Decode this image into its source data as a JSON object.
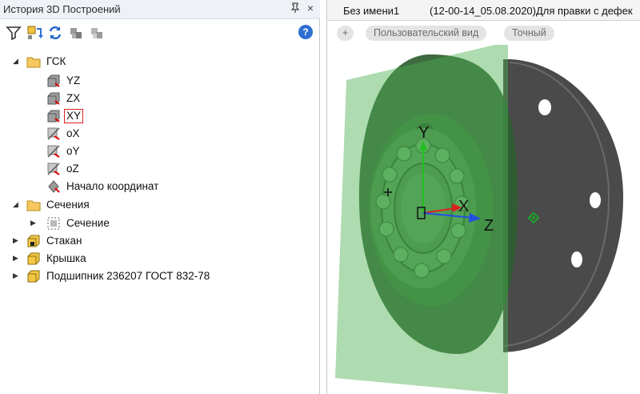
{
  "left_panel": {
    "title": "История 3D Построений",
    "pin_glyph": "ᵖ",
    "close_glyph": "×",
    "toolbar": {
      "icons": [
        "filter-icon",
        "rollback-icon",
        "rebuild-icon",
        "component-icon",
        "component-gray-icon"
      ],
      "help_label": "?"
    },
    "tree": {
      "gsk": "ГСК",
      "yz": "YZ",
      "zx": "ZX",
      "xy": "XY",
      "ox": "oX",
      "oy": "oY",
      "oz": "oZ",
      "origin": "Начало координат",
      "sections": "Сечения",
      "section": "Сечение",
      "part1": "Стакан",
      "part2": "Крышка",
      "part3": "Подшипник 236207 ГОСТ 832-78"
    }
  },
  "right_panel": {
    "tab_name": "Без имени1",
    "tab_subtitle": "(12-00-14_05.08.2020)Для правки с дефек",
    "view_bar": {
      "add": "+",
      "view": "Пользовательский вид",
      "mode": "Точный"
    },
    "axes": {
      "y": "Y",
      "x": "X",
      "z": "Z"
    },
    "colors": {
      "plane": "#4caf50",
      "part": "#4a4a4a",
      "x_axis": "#e02020",
      "y_axis": "#20c020",
      "z_axis": "#2050e0"
    }
  }
}
